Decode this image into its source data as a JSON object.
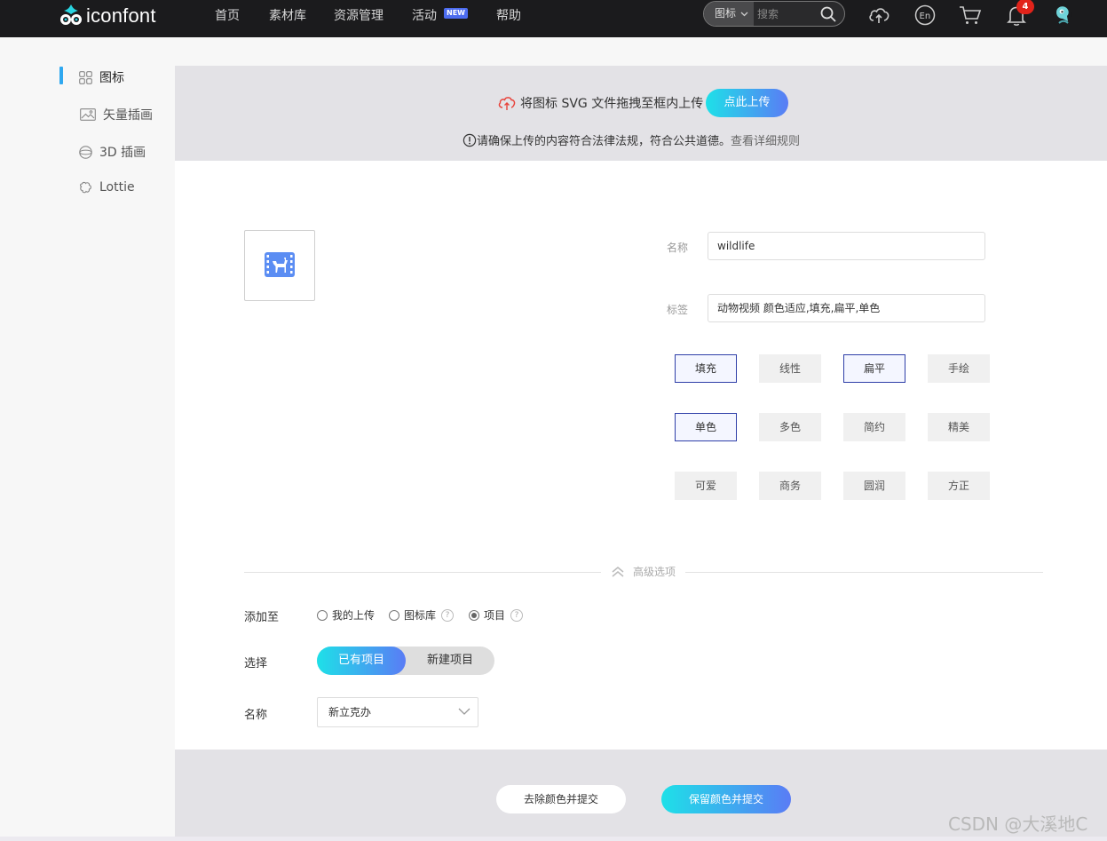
{
  "brand": {
    "logo_text": "iconfont"
  },
  "nav": {
    "items": [
      "首页",
      "素材库",
      "资源管理",
      "活动",
      "帮助"
    ],
    "new_badge": "NEW"
  },
  "search": {
    "type_label": "图标",
    "placeholder": "搜索"
  },
  "toolbar": {
    "notification_count": "4",
    "icons": [
      "upload-cloud-icon",
      "language-en-icon",
      "cart-icon",
      "bell-icon",
      "avatar"
    ]
  },
  "sidebar": {
    "items": [
      {
        "label": "图标",
        "icon": "grid-icon",
        "active": true
      },
      {
        "label": "矢量插画",
        "icon": "image-icon",
        "active": false
      },
      {
        "label": "3D 插画",
        "icon": "sphere-icon",
        "active": false
      },
      {
        "label": "Lottie",
        "icon": "lottie-icon",
        "active": false
      }
    ]
  },
  "upload": {
    "text": "将图标 SVG 文件拖拽至框内上传",
    "button": "点此上传",
    "rule_text": "请确保上传的内容符合法律法规，符合公共道德。",
    "rule_link": "查看详细规则"
  },
  "form": {
    "name_label": "名称",
    "name_value": "wildlife",
    "tags_label": "标签",
    "tags_value": "动物视频 颜色适应,填充,扁平,单色",
    "tag_options": [
      {
        "label": "填充",
        "selected": true
      },
      {
        "label": "线性",
        "selected": false
      },
      {
        "label": "扁平",
        "selected": true
      },
      {
        "label": "手绘",
        "selected": false
      },
      {
        "label": "单色",
        "selected": true
      },
      {
        "label": "多色",
        "selected": false
      },
      {
        "label": "简约",
        "selected": false
      },
      {
        "label": "精美",
        "selected": false
      },
      {
        "label": "可爱",
        "selected": false
      },
      {
        "label": "商务",
        "selected": false
      },
      {
        "label": "圆润",
        "selected": false
      },
      {
        "label": "方正",
        "selected": false
      }
    ]
  },
  "advanced": {
    "label": "高级选项",
    "add_to_label": "添加至",
    "add_to_options": [
      {
        "label": "我的上传",
        "checked": false,
        "help": false
      },
      {
        "label": "图标库",
        "checked": false,
        "help": true
      },
      {
        "label": "项目",
        "checked": true,
        "help": true
      }
    ],
    "help_mark": "?",
    "select_label": "选择",
    "segments": [
      "已有项目",
      "新建项目"
    ],
    "project_name_label": "名称",
    "project_name_value": "新立克办"
  },
  "footer": {
    "remove_color_button": "去除颜色并提交",
    "keep_color_button": "保留颜色并提交"
  },
  "watermark": "CSDN @大溪地C",
  "colors": {
    "accent_start": "#1ee0e8",
    "accent_end": "#5a7cf5",
    "nav_bg": "#1b1b1d",
    "selected_border": "#2e3ea8",
    "notification": "#e2231a"
  }
}
